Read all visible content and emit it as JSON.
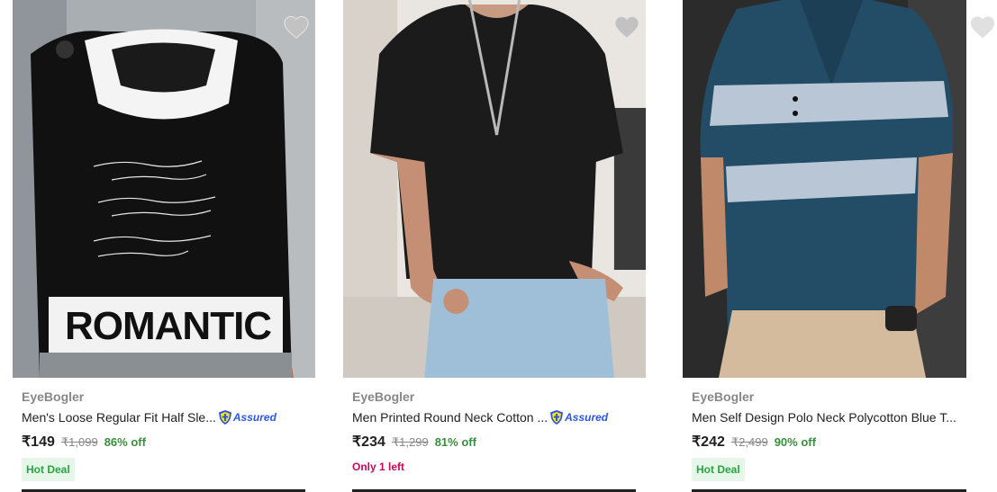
{
  "colors": {
    "brand_grey": "#878787",
    "title": "#212121",
    "discount_green": "#388e3c",
    "hot_deal_bg": "#e6f6e8",
    "hot_deal_text": "#26a541",
    "only_left": "#c7085b",
    "assured_blue": "#2a55e5"
  },
  "icons": {
    "wishlist": "heart-icon",
    "assured": "flipkart-assured-badge-icon"
  },
  "products": [
    {
      "image_alt": "Black hooded t-shirt with ROMANTIC print",
      "image_print_text": "ROMANTIC",
      "brand": "EyeBogler",
      "title": "Men's Loose Regular Fit Half Sle...",
      "assured_label": "Assured",
      "price": "₹149",
      "mrp": "₹1,099",
      "discount": "86% off",
      "tag": "Hot Deal"
    },
    {
      "image_alt": "Black waffle round neck t-shirt",
      "brand": "EyeBogler",
      "title": "Men Printed Round Neck Cotton ...",
      "assured_label": "Assured",
      "price": "₹234",
      "mrp": "₹1,299",
      "discount": "81% off",
      "stock_note": "Only 1 left"
    },
    {
      "image_alt": "Blue and grey striped polo t-shirt",
      "brand": "EyeBogler",
      "title": "Men Self Design Polo Neck Polycotton Blue T...",
      "price": "₹242",
      "mrp": "₹2,499",
      "discount": "90% off",
      "tag": "Hot Deal"
    }
  ]
}
